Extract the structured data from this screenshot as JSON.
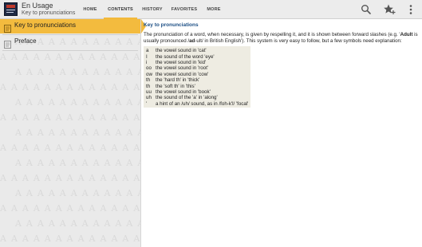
{
  "app": {
    "title": "En Usage",
    "subtitle": "Key to pronunciations"
  },
  "tabs": [
    {
      "label": "HOME",
      "active": false
    },
    {
      "label": "CONTENTS",
      "active": true
    },
    {
      "label": "HISTORY",
      "active": false
    },
    {
      "label": "FAVORITES",
      "active": false
    },
    {
      "label": "MORE",
      "active": false
    }
  ],
  "actions": {
    "search_icon": "search-icon",
    "favorite_icon": "star-add-icon",
    "overflow_icon": "overflow-menu-icon"
  },
  "sidebar": {
    "watermark_glyph": "A",
    "items": [
      {
        "label": "Key to pronunciations",
        "selected": true
      },
      {
        "label": "Preface",
        "selected": false
      }
    ]
  },
  "content": {
    "heading": "Key to pronunciations",
    "intro_1": "The pronunciation of a word, when necessary, is given by respelling it, and it is shown between forward slashes (e.g. '",
    "intro_bold_word": "Adult",
    "intro_2": " is usually pronounced /",
    "intro_bold_resp": "ad",
    "intro_3": "-ult/ in British English'). This system is very easy to follow, but a few symbols need explanation:",
    "keys": [
      {
        "symbol": "a",
        "description": "the vowel sound in 'cat'"
      },
      {
        "symbol": "I",
        "description": "the sound of the word 'eye'"
      },
      {
        "symbol": "i",
        "description": "the vowel sound in 'kid'"
      },
      {
        "symbol": "oo",
        "description": "the vowel sound in 'root'"
      },
      {
        "symbol": "ow",
        "description": "the vowel sound in 'cow'"
      },
      {
        "symbol": "th",
        "description": "the 'hard th' in 'thick'"
      },
      {
        "symbol": "th",
        "description": "the 'soft th' in 'this'"
      },
      {
        "symbol": "uu",
        "description": "the vowel sound in 'book'"
      },
      {
        "symbol": "uh",
        "description": "the sound of the 'a' in 'along'"
      },
      {
        "symbol": "'",
        "description": "a hint of an /uh/ sound, as in /foh-k'l/ 'focal'"
      }
    ]
  },
  "colors": {
    "accent": "#f3bb3e",
    "heading": "#1c4f85",
    "keys_background": "#eeece2"
  }
}
